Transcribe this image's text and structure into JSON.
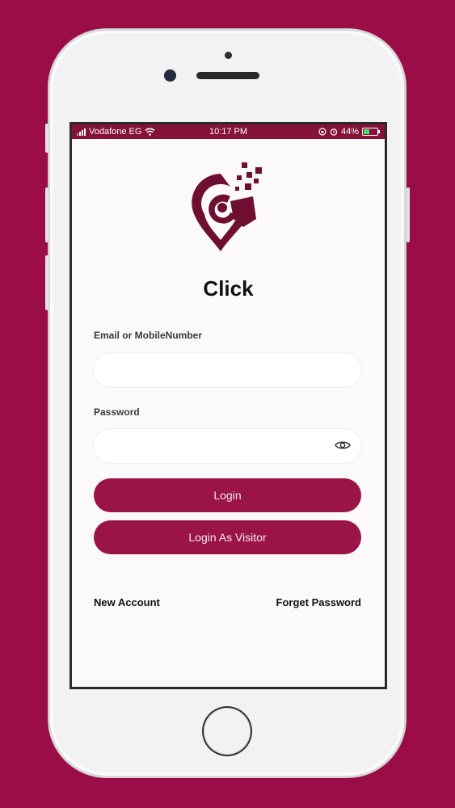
{
  "status_bar": {
    "carrier": "Vodafone EG",
    "time": "10:17 PM",
    "battery": "44%",
    "battery_level": 0.44
  },
  "app": {
    "title": "Click"
  },
  "form": {
    "email_label": "Email or MobileNumber",
    "email_value": "",
    "password_label": "Password",
    "password_value": ""
  },
  "buttons": {
    "login": "Login",
    "visitor": "Login As Visitor"
  },
  "links": {
    "new_account": "New Account",
    "forget_password": "Forget Password"
  },
  "colors": {
    "background": "#9a0d47",
    "accent": "#9a1447",
    "status_bar": "#851038",
    "logo": "#6e0f32"
  },
  "icons": {
    "password_toggle": "eye-icon",
    "wifi": "wifi-icon",
    "battery": "battery-icon",
    "alarm": "alarm-icon",
    "lock_rotation": "rotation-lock-icon"
  }
}
